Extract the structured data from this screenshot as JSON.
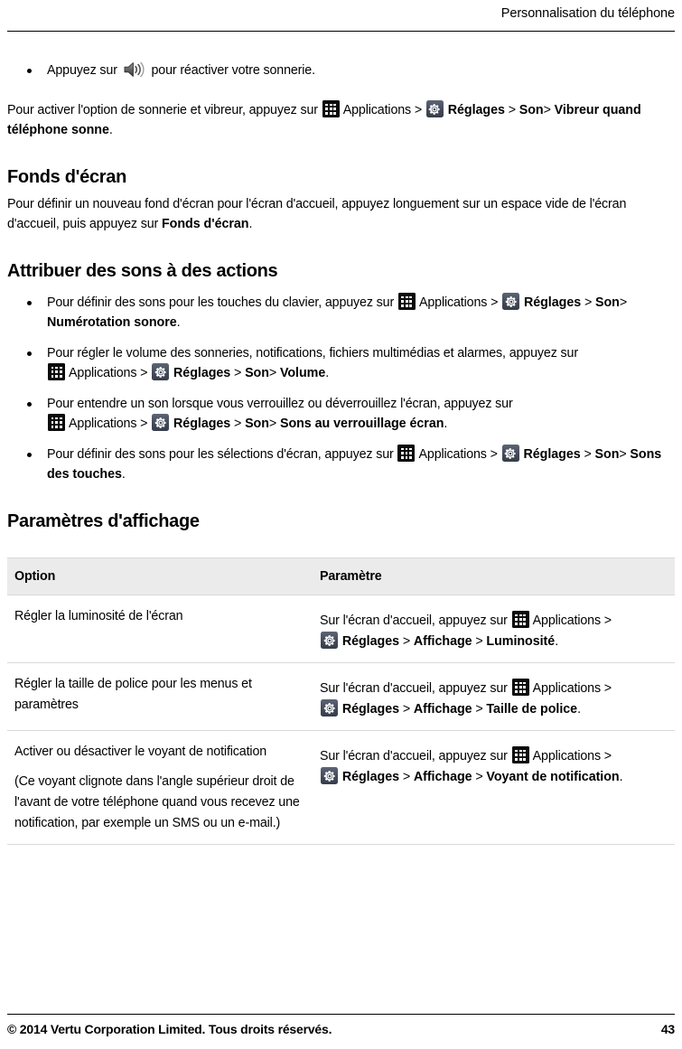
{
  "header": {
    "title": "Personnalisation du téléphone"
  },
  "icons": {
    "apps": "apps-grid-icon",
    "gear": "settings-gear-icon",
    "speaker": "speaker-volume-icon"
  },
  "labels": {
    "applications": "Applications",
    "reglages": "Réglages",
    "chevron": ">"
  },
  "ringer_bullet": {
    "before_icon": "Appuyez sur",
    "after_icon": "pour réactiver votre sonnerie."
  },
  "ringer_para": {
    "t1": "Pour activer l'option de sonnerie et vibreur, appuyez sur",
    "applications": "Applications",
    "sep1": ">",
    "reglages": "Réglages",
    "sep2": ">",
    "son": "Son",
    "sep3": ">",
    "final": "Vibreur quand téléphone sonne",
    "period": "."
  },
  "wallpaper": {
    "heading": "Fonds d'écran",
    "body_1": "Pour définir un nouveau fond d'écran pour l'écran d'accueil, appuyez longuement sur un espace vide de l'écran d'accueil, puis appuyez sur",
    "bold_target": "Fonds d'écran",
    "period": "."
  },
  "sounds": {
    "heading": "Attribuer des sons à des actions",
    "items": [
      {
        "lead": "Pour définir des sons pour les touches du clavier, appuyez sur",
        "applications": "Applications",
        "reglages": "Réglages",
        "son": "Son",
        "final": "Numérotation sonore",
        "period": "."
      },
      {
        "lead": "Pour régler le volume des sonneries, notifications, fichiers multimédias et alarmes, appuyez sur",
        "applications": "Applications",
        "reglages": "Réglages",
        "son": "Son",
        "final": "Volume",
        "period": "."
      },
      {
        "lead": "Pour entendre un son lorsque vous verrouillez ou déverrouillez l'écran, appuyez sur",
        "applications": "Applications",
        "reglages": "Réglages",
        "son": "Son",
        "final": "Sons au verrouillage écran",
        "period": "."
      },
      {
        "lead": "Pour définir des sons pour les sélections d'écran, appuyez sur",
        "applications": "Applications",
        "reglages": "Réglages",
        "son": "Son",
        "final": "Sons des touches",
        "period": "."
      }
    ]
  },
  "display": {
    "heading": "Paramètres d'affichage",
    "table": {
      "columns": [
        "Option",
        "Paramètre"
      ],
      "rows": [
        {
          "option": "Régler la luminosité de l'écran",
          "option_note": "",
          "value_lead": "Sur l'écran d'accueil, appuyez sur",
          "applications": "Applications",
          "reglages": "Réglages",
          "affichage": "Affichage",
          "final": "Luminosité",
          "period": "."
        },
        {
          "option": "Régler la taille de police pour les menus et paramètres",
          "option_note": "",
          "value_lead": "Sur l'écran d'accueil, appuyez sur",
          "applications": "Applications",
          "reglages": "Réglages",
          "affichage": "Affichage",
          "final": "Taille de police",
          "period": "."
        },
        {
          "option": "Activer ou désactiver le voyant de notification",
          "option_note": "(Ce voyant clignote dans l'angle supérieur droit de l'avant de votre téléphone quand vous recevez une notification, par exemple un SMS ou un e-mail.)",
          "value_lead": "Sur l'écran d'accueil, appuyez sur",
          "applications": "Applications",
          "reglages": "Réglages",
          "affichage": "Affichage",
          "final": "Voyant de notification",
          "period": "."
        }
      ]
    }
  },
  "footer": {
    "copyright": "© 2014 Vertu Corporation Limited. Tous droits réservés.",
    "page_number": "43"
  }
}
